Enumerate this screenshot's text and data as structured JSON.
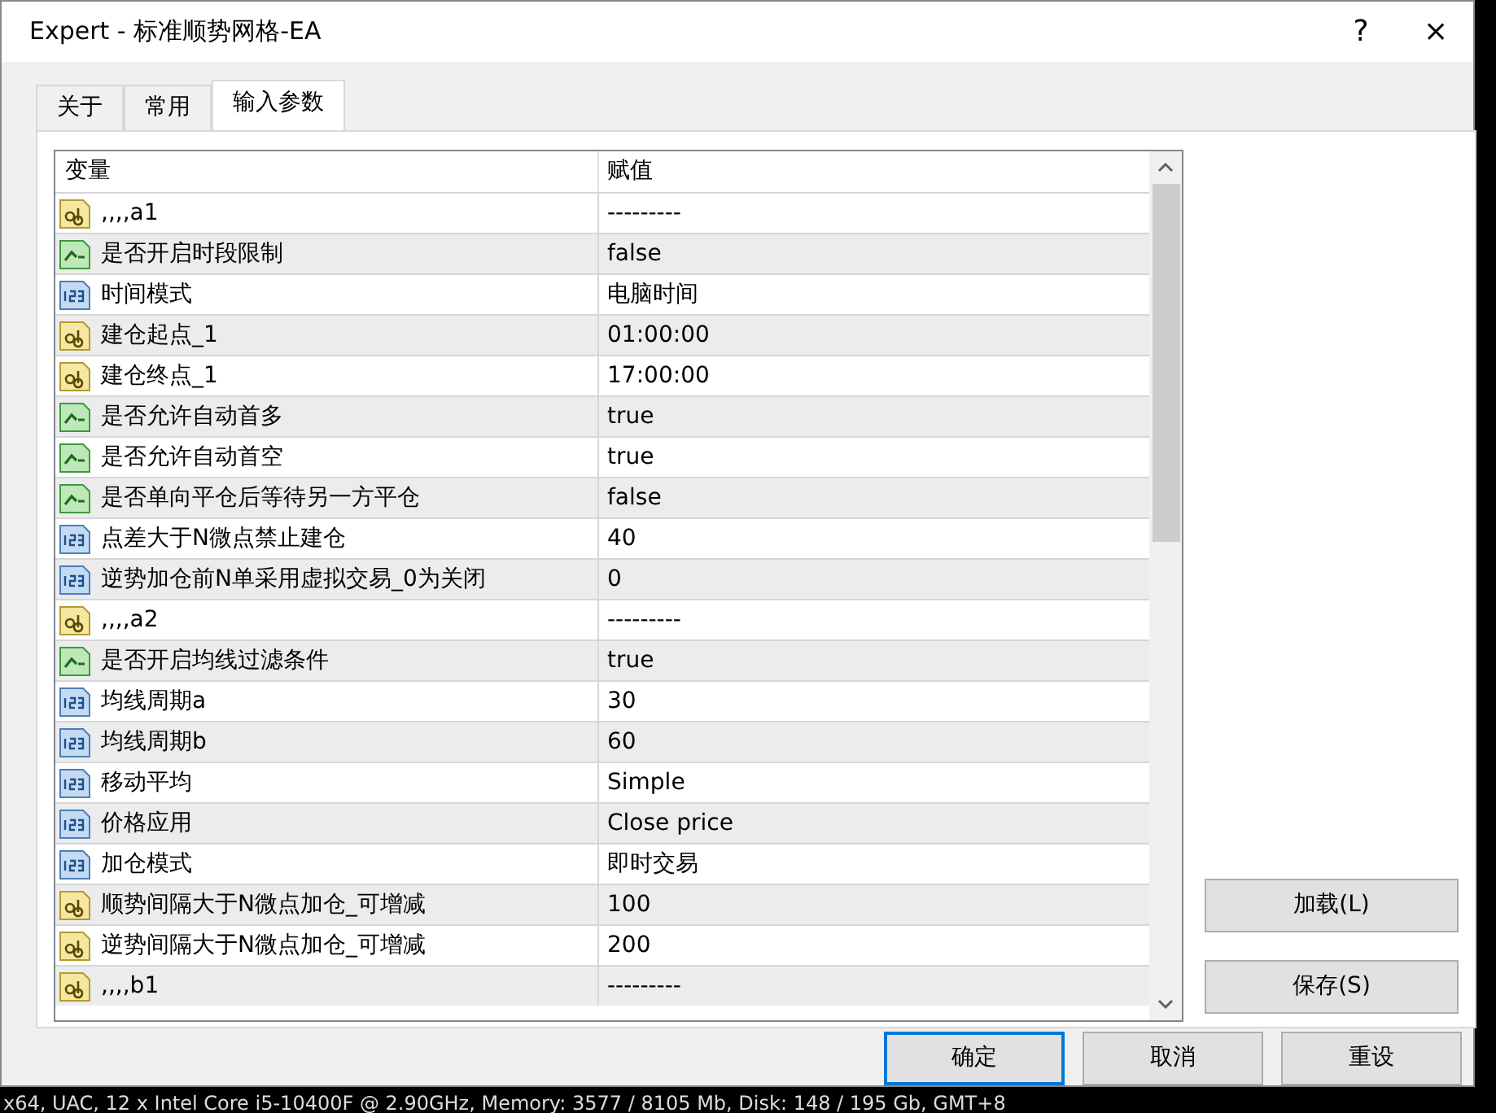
{
  "window": {
    "title": "Expert - 标准顺势网格-EA",
    "buttons": [
      "?",
      "×"
    ]
  },
  "tabs": [
    {
      "label": "关于",
      "selected": false
    },
    {
      "label": "常用",
      "selected": false
    },
    {
      "label": "输入参数",
      "selected": true
    }
  ],
  "table": {
    "columns": [
      "变量",
      "赋值"
    ],
    "rows": [
      {
        "kind": "string",
        "name": ",,,,a1",
        "value": "---------"
      },
      {
        "kind": "bool",
        "name": "是否开启时段限制",
        "value": "false"
      },
      {
        "kind": "number",
        "name": "时间模式",
        "value": "电脑时间"
      },
      {
        "kind": "string",
        "name": "建仓起点_1",
        "value": "01:00:00"
      },
      {
        "kind": "string",
        "name": "建仓终点_1",
        "value": "17:00:00"
      },
      {
        "kind": "bool",
        "name": "是否允许自动首多",
        "value": "true"
      },
      {
        "kind": "bool",
        "name": "是否允许自动首空",
        "value": "true"
      },
      {
        "kind": "bool",
        "name": "是否单向平仓后等待另一方平仓",
        "value": "false"
      },
      {
        "kind": "number",
        "name": "点差大于N微点禁止建仓",
        "value": "40"
      },
      {
        "kind": "number",
        "name": "逆势加仓前N单采用虚拟交易_0为关闭",
        "value": "0"
      },
      {
        "kind": "string",
        "name": ",,,,a2",
        "value": "---------"
      },
      {
        "kind": "bool",
        "name": "是否开启均线过滤条件",
        "value": "true"
      },
      {
        "kind": "number",
        "name": "均线周期a",
        "value": "30"
      },
      {
        "kind": "number",
        "name": "均线周期b",
        "value": "60"
      },
      {
        "kind": "number",
        "name": "移动平均",
        "value": "Simple"
      },
      {
        "kind": "number",
        "name": "价格应用",
        "value": "Close price"
      },
      {
        "kind": "number",
        "name": "加仓模式",
        "value": "即时交易"
      },
      {
        "kind": "string",
        "name": "顺势间隔大于N微点加仓_可增减",
        "value": "100"
      },
      {
        "kind": "string",
        "name": "逆势间隔大于N微点加仓_可增减",
        "value": "200"
      },
      {
        "kind": "string",
        "name": ",,,,b1",
        "value": "---------"
      }
    ]
  },
  "side_buttons": [
    "加载(L)",
    "保存(S)"
  ],
  "footer_buttons": [
    {
      "label": "确定",
      "selected": true
    },
    {
      "label": "取消",
      "selected": false
    },
    {
      "label": "重设",
      "selected": false
    }
  ],
  "status_bar": "x64, UAC, 12 x Intel Core i5-10400F @ 2.90GHz, Memory: 3577 / 8105 Mb, Disk: 148 / 195 Gb, GMT+8"
}
